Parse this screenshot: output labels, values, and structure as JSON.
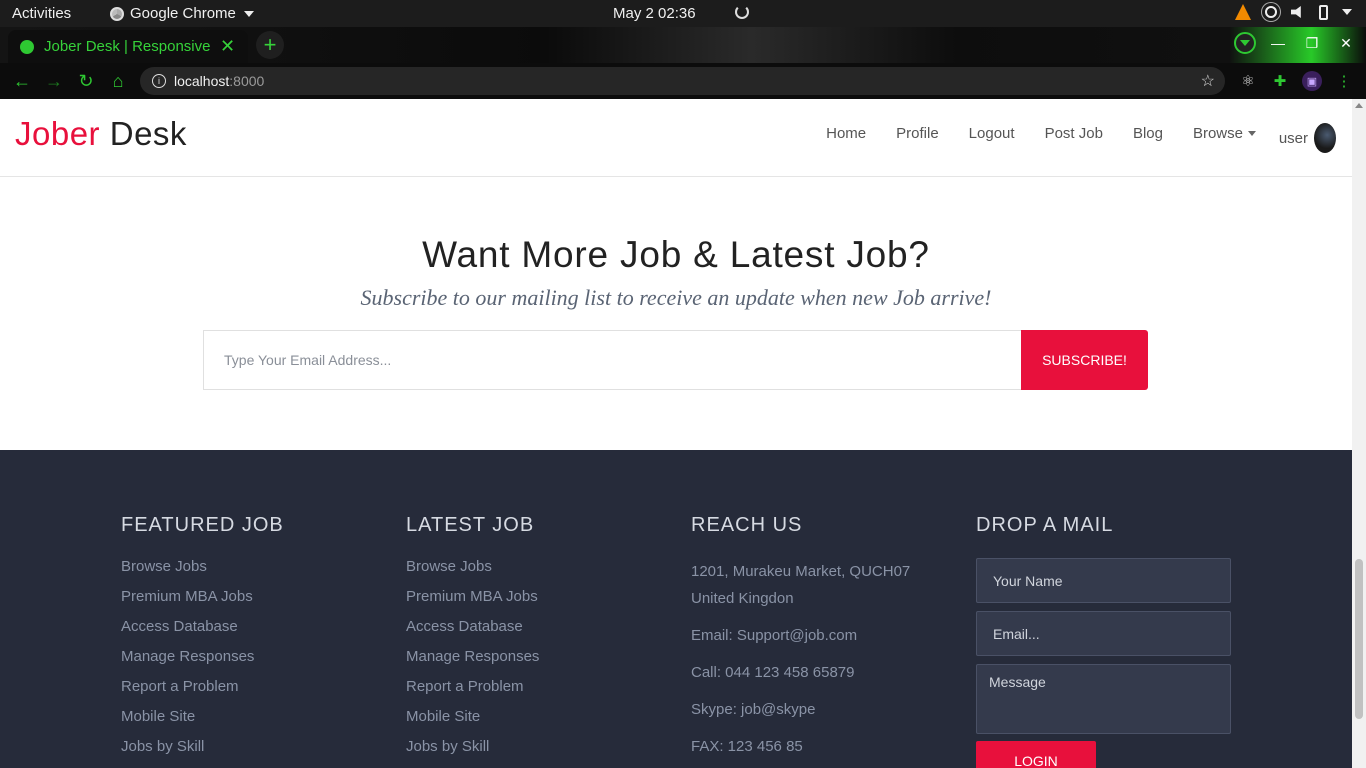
{
  "os": {
    "activities": "Activities",
    "app_name": "Google Chrome",
    "clock": "May 2  02:36"
  },
  "browser": {
    "tab_title": "Jober Desk | Responsive J",
    "url_host": "localhost",
    "url_port": ":8000"
  },
  "header": {
    "logo_part1": "Jober",
    "logo_part2": "Desk",
    "nav": [
      "Home",
      "Profile",
      "Logout",
      "Post Job",
      "Blog",
      "Browse"
    ],
    "user_label": "user"
  },
  "subscribe": {
    "heading": "Want More Job & Latest Job?",
    "subheading": "Subscribe to our mailing list to receive an update when new Job arrive!",
    "email_placeholder": "Type Your Email Address...",
    "button_label": "SUBSCRIBE!"
  },
  "footer": {
    "featured": {
      "title": "FEATURED JOB",
      "links": [
        "Browse Jobs",
        "Premium MBA Jobs",
        "Access Database",
        "Manage Responses",
        "Report a Problem",
        "Mobile Site",
        "Jobs by Skill"
      ]
    },
    "latest": {
      "title": "LATEST JOB",
      "links": [
        "Browse Jobs",
        "Premium MBA Jobs",
        "Access Database",
        "Manage Responses",
        "Report a Problem",
        "Mobile Site",
        "Jobs by Skill"
      ]
    },
    "reach": {
      "title": "REACH US",
      "address_line1": "1201, Murakeu Market, QUCH07",
      "address_line2": "United Kingdon",
      "email": "Email: Support@job.com",
      "call": "Call: 044 123 458 65879",
      "skype": "Skype: job@skype",
      "fax": "FAX: 123 456 85"
    },
    "mail": {
      "title": "DROP A MAIL",
      "name_placeholder": "Your Name",
      "email_placeholder": "Email...",
      "message_placeholder": "Message",
      "button_label": "LOGIN"
    }
  },
  "colors": {
    "accent": "#e8103c",
    "footer_bg": "#262b3a",
    "chrome_accent": "#2ec832"
  }
}
